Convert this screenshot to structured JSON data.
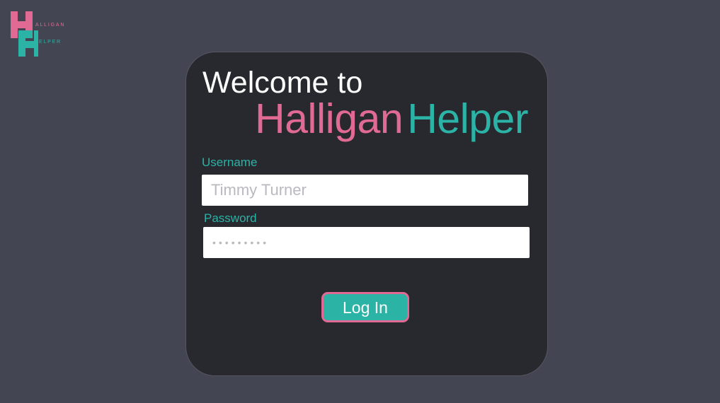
{
  "logo": {
    "word_1": "ALLIGAN",
    "word_2": "ELPER",
    "icon": "halligan-helper-hh-logo",
    "colors": {
      "pink": "#e06a93",
      "teal": "#2bb3a6"
    }
  },
  "card": {
    "welcome": "Welcome to",
    "brand_first": "Halligan",
    "brand_second": "Helper"
  },
  "form": {
    "username_label": "Username",
    "username_placeholder": "Timmy Turner",
    "password_label": "Password",
    "password_value": "•••••••••",
    "login_label": "Log In"
  },
  "colors": {
    "background": "#434652",
    "card": "#28282f",
    "accent_pink": "#e06a93",
    "accent_teal": "#2bb3a6"
  }
}
